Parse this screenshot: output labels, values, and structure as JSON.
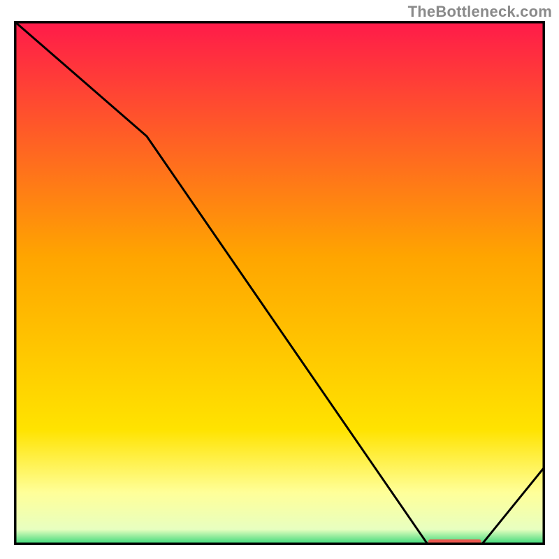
{
  "attribution": "TheBottleneck.com",
  "chart_data": {
    "type": "line",
    "title": "",
    "xlabel": "",
    "ylabel": "",
    "xlim": [
      0,
      100
    ],
    "ylim": [
      0,
      100
    ],
    "series": [
      {
        "name": "bottleneck-curve",
        "x": [
          0,
          25,
          78,
          88,
          100
        ],
        "values": [
          100,
          78,
          0,
          0,
          15
        ]
      }
    ],
    "marker": {
      "name": "optimal-zone",
      "x_range": [
        78,
        88
      ],
      "y": 0,
      "color": "#e9574e"
    },
    "background_gradient": {
      "stops": [
        {
          "offset": 0.0,
          "color": "#ff1a4a"
        },
        {
          "offset": 0.45,
          "color": "#ffa500"
        },
        {
          "offset": 0.78,
          "color": "#ffe300"
        },
        {
          "offset": 0.9,
          "color": "#ffff99"
        },
        {
          "offset": 0.97,
          "color": "#e8ffc0"
        },
        {
          "offset": 1.0,
          "color": "#2ed573"
        }
      ]
    }
  }
}
